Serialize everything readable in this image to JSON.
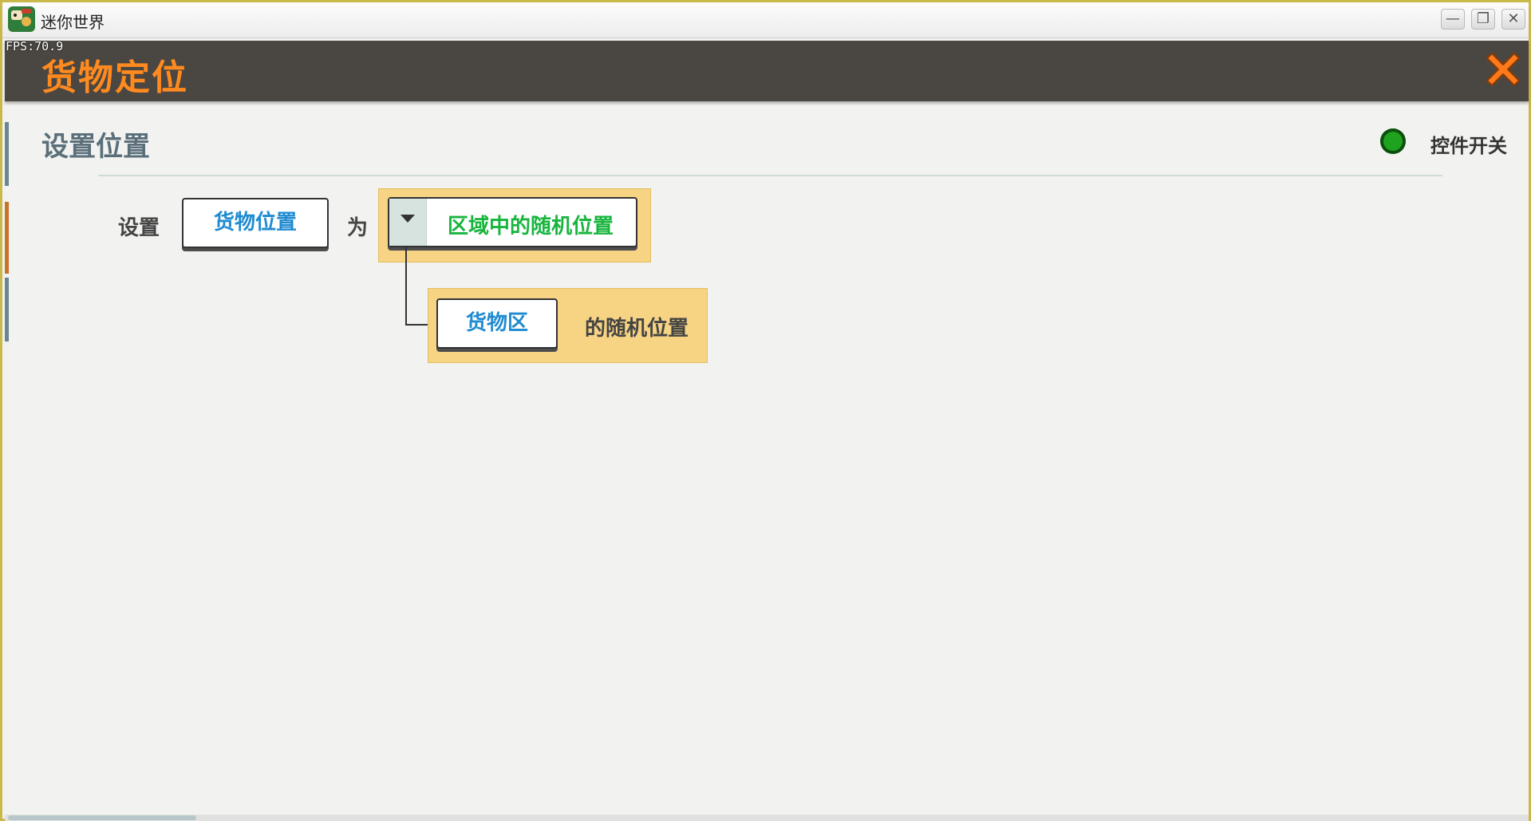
{
  "os_window": {
    "title": "迷你世界",
    "minimize_glyph": "—",
    "restore_glyph": "❐",
    "close_glyph": "✕"
  },
  "fps_text": "FPS:70.9",
  "header": {
    "title": "货物定位",
    "close_icon": "close-x-icon"
  },
  "section": {
    "title": "设置位置",
    "toggle_label": "控件开关",
    "toggle_state": "on",
    "toggle_color": "#1fa31f"
  },
  "rule": {
    "prefix": "设置",
    "target": "货物位置",
    "connector_word": "为",
    "value_dropdown": "区域中的随机位置",
    "sub_area": "货物区",
    "sub_suffix": "的随机位置"
  },
  "colors": {
    "header_bg": "#4a4641",
    "header_title": "#ff8a1f",
    "field_text": "#1f8bd0",
    "dropdown_text": "#18b53e",
    "highlight_bg": "#f7d484"
  }
}
